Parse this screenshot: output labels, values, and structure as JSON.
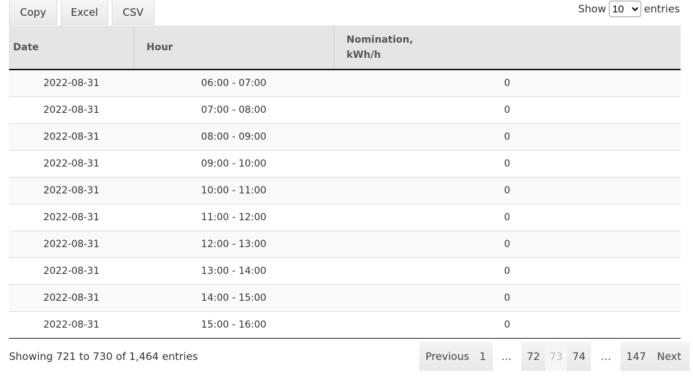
{
  "toolbar": {
    "copy": "Copy",
    "excel": "Excel",
    "csv": "CSV"
  },
  "length": {
    "prefix": "Show",
    "value": "10",
    "suffix": "entries"
  },
  "table": {
    "headers": {
      "date": "Date",
      "hour": "Hour",
      "nomination": "Nomination,\nkWh/h"
    },
    "rows": [
      {
        "date": "2022-08-31",
        "hour": "06:00 - 07:00",
        "value": "0"
      },
      {
        "date": "2022-08-31",
        "hour": "07:00 - 08:00",
        "value": "0"
      },
      {
        "date": "2022-08-31",
        "hour": "08:00 - 09:00",
        "value": "0"
      },
      {
        "date": "2022-08-31",
        "hour": "09:00 - 10:00",
        "value": "0"
      },
      {
        "date": "2022-08-31",
        "hour": "10:00 - 11:00",
        "value": "0"
      },
      {
        "date": "2022-08-31",
        "hour": "11:00 - 12:00",
        "value": "0"
      },
      {
        "date": "2022-08-31",
        "hour": "12:00 - 13:00",
        "value": "0"
      },
      {
        "date": "2022-08-31",
        "hour": "13:00 - 14:00",
        "value": "0"
      },
      {
        "date": "2022-08-31",
        "hour": "14:00 - 15:00",
        "value": "0"
      },
      {
        "date": "2022-08-31",
        "hour": "15:00 - 16:00",
        "value": "0"
      }
    ]
  },
  "info": "Showing 721 to 730 of 1,464 entries",
  "pagination": {
    "previous": "Previous",
    "p1": "1",
    "ellipsis1": "…",
    "p72": "72",
    "p73": "73",
    "p74": "74",
    "ellipsis2": "…",
    "p147": "147",
    "next": "Next",
    "current": "73"
  }
}
